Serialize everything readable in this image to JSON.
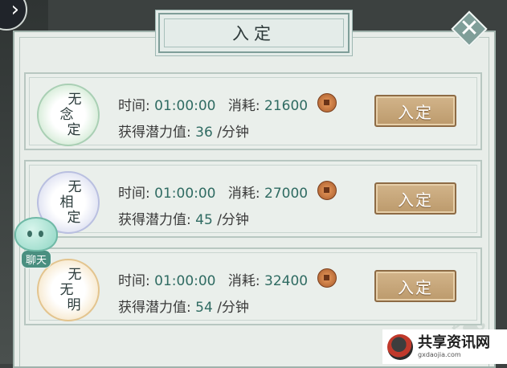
{
  "window": {
    "title": "入定"
  },
  "chat": {
    "label": "聊天"
  },
  "labels": {
    "time": "时间:",
    "cost": "消耗:",
    "gain": "获得潜力值:",
    "unit": "/分钟"
  },
  "items": [
    {
      "name_chars": [
        "无",
        "念",
        "定"
      ],
      "time": "01:00:00",
      "cost": "21600",
      "gain": "36",
      "button": "入定",
      "color": "#b7d7c1"
    },
    {
      "name_chars": [
        "无",
        "相",
        "定"
      ],
      "time": "01:00:00",
      "cost": "27000",
      "gain": "45",
      "button": "入定",
      "color": "#c4c9e6"
    },
    {
      "name_chars": [
        "无",
        "无",
        "明"
      ],
      "time": "01:00:00",
      "cost": "32400",
      "gain": "54",
      "button": "入定",
      "color": "#ecd3a3"
    }
  ],
  "watermark": {
    "text": "共享资讯网",
    "sub": "gxdaojia.com"
  }
}
